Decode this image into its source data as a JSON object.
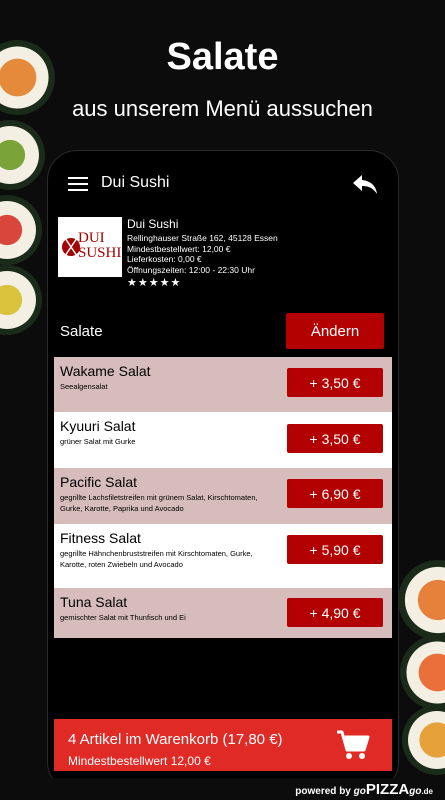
{
  "promo": {
    "title": "Salate",
    "subtitle": "aus unserem Menü aussuchen"
  },
  "appbar": {
    "title": "Dui Sushi"
  },
  "restaurant": {
    "logo_text_1": "DUI",
    "logo_text_2": "SUSHI",
    "name": "Dui Sushi",
    "address": "Rellinghauser Straße 162, 45128 Essen",
    "min_order": "Mindestbestellwert: 12,00 €",
    "delivery_cost": "Lieferkosten: 0,00 €",
    "hours": "Öffnungszeiten: 12:00 - 22:30 Uhr",
    "rating": "★★★★★"
  },
  "category": {
    "label": "Salate",
    "change_label": "Ändern"
  },
  "items": [
    {
      "name": "Wakame Salat",
      "desc": "Seealgensalat",
      "price": "+ 3,50 €"
    },
    {
      "name": "Kyuuri Salat",
      "desc": "grüner Salat mit Gurke",
      "price": "+ 3,50 €"
    },
    {
      "name": "Pacific Salat",
      "desc": "gegrillte Lachsfiletstreifen mit grünem Salat, Kirschtomaten, Gurke, Karotte, Paprika und Avocado",
      "price": "+ 6,90 €"
    },
    {
      "name": "Fitness Salat",
      "desc": "gegrillte Hähnchenbruststreifen mit Kirschtomaten, Gurke, Karotte, roten Zwiebeln und Avocado",
      "price": "+ 5,90 €"
    },
    {
      "name": "Tuna Salat",
      "desc": "gemischter Salat mit Thunfisch und Ei",
      "price": "+ 4,90 €"
    }
  ],
  "cart": {
    "title": "4 Artikel im Warenkorb (17,80 €)",
    "min_order": "Mindestbestellwert 12,00 €"
  },
  "footer": {
    "powered_by": "powered by",
    "brand_go": "go",
    "brand_pizza": "PIZZA",
    "brand_go2": "go",
    "brand_tld": ".de"
  },
  "colors": {
    "accent": "#b30000",
    "cart": "#e02a25",
    "item_alt": "#d6bcbb"
  }
}
